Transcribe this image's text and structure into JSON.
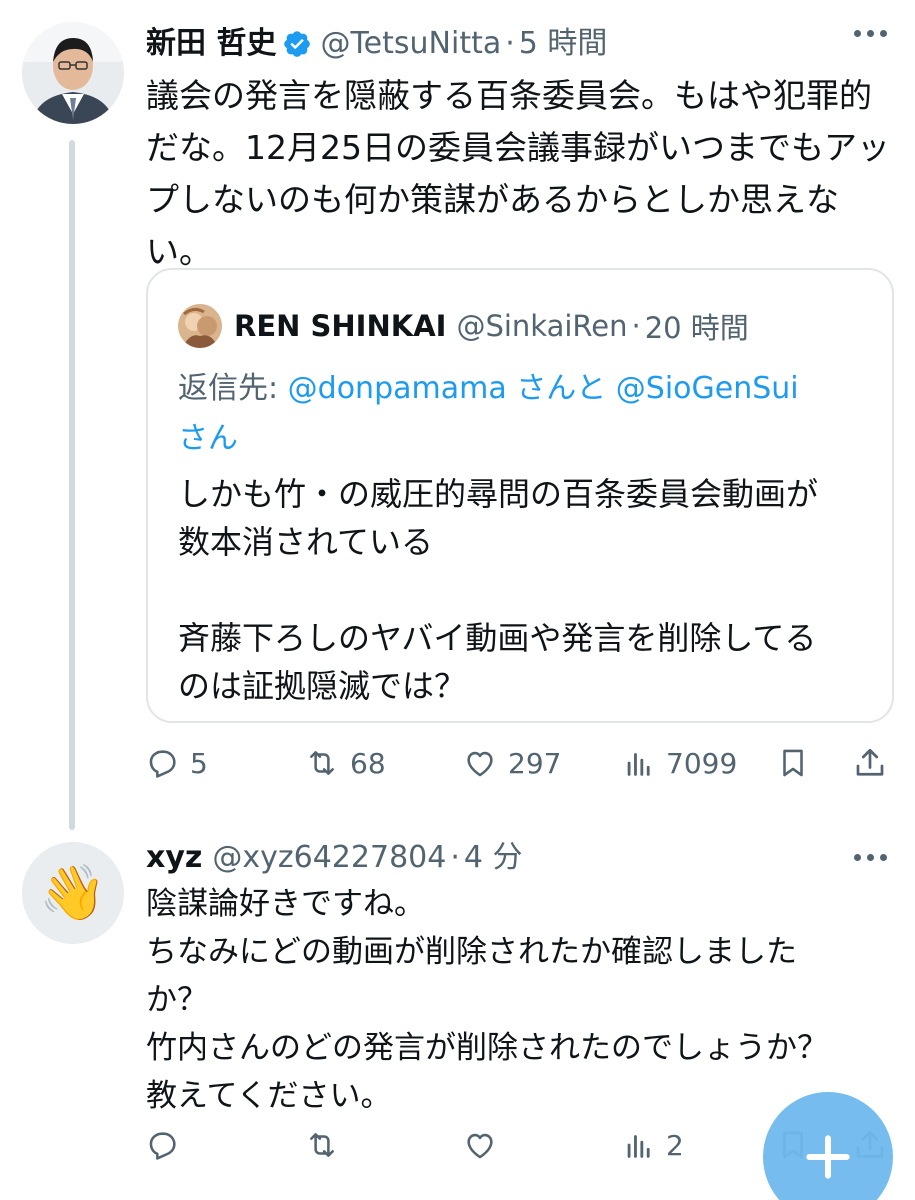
{
  "tweet": {
    "author_name": "新田 哲史",
    "handle": "@TetsuNitta",
    "separator": "·",
    "time": "5 時間",
    "text": "議会の発言を隠蔽する百条委員会。もはや犯罪的\nだな。12月25日の委員会議事録がいつまでもアッ\nプしないのも何か策謀があるからとしか思えな\nい。",
    "quote": {
      "author_name": "REN SHINKAI",
      "handle": "@SinkaiRen",
      "separator": "·",
      "time": "20 時間",
      "reply_prefix": "返信先: ",
      "reply_user1": "@donpamama",
      "reply_mid": " さんと ",
      "reply_user2": "@SioGenSui",
      "reply_suffix": "さん",
      "text": "しかも竹・の威圧的尋問の百条委員会動画が\n数本消されている\n\n斉藤下ろしのヤバイ動画や発言を削除してる\nのは証拠隠滅では？"
    },
    "actions": {
      "replies": "5",
      "reposts": "68",
      "likes": "297",
      "views": "7099"
    }
  },
  "reply": {
    "author_name": "xyz",
    "handle": "@xyz64227804",
    "separator": "·",
    "time": "4 分",
    "avatar_emoji": "👋",
    "text": "陰謀論好きですね。\nちなみにどの動画が削除されたか確認しました\nか？\n竹内さんのどの発言が削除されたのでしょうか？\n教えてください。",
    "actions": {
      "replies": "",
      "reposts": "",
      "likes": "",
      "views": "2"
    }
  },
  "fab": {
    "icon": "compose-plus-icon"
  },
  "colors": {
    "link": "#1d9bf0",
    "muted": "#536471",
    "verified": "#1d9bf0",
    "fab": "#6fb9ee"
  }
}
